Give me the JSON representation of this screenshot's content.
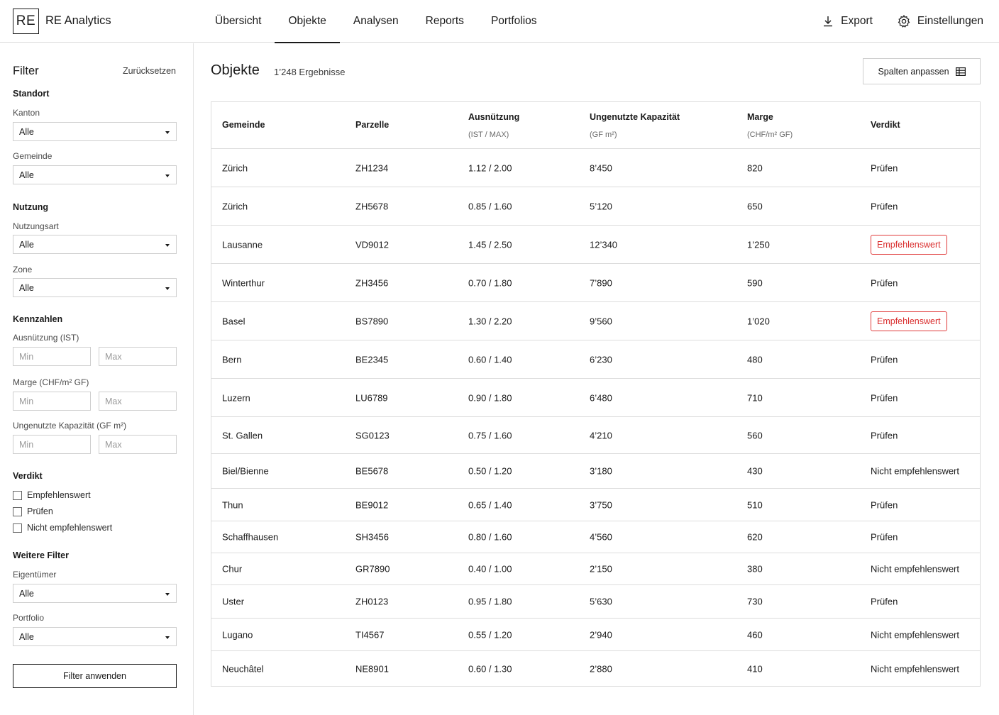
{
  "app": {
    "logo": "RE",
    "name": "RE Analytics"
  },
  "nav": {
    "tabs": [
      {
        "label": "Übersicht"
      },
      {
        "label": "Objekte",
        "active": true
      },
      {
        "label": "Analysen"
      },
      {
        "label": "Reports"
      },
      {
        "label": "Portfolios"
      }
    ],
    "export_label": "Export",
    "settings_label": "Einstellungen"
  },
  "sidebar": {
    "title": "Filter",
    "reset": "Zurücksetzen",
    "standort": {
      "title": "Standort",
      "kanton_label": "Kanton",
      "kanton_value": "Alle",
      "gemeinde_label": "Gemeinde",
      "gemeinde_value": "Alle"
    },
    "nutzung": {
      "title": "Nutzung",
      "nutzungsart_label": "Nutzungsart",
      "nutzungsart_value": "Alle",
      "zone_label": "Zone",
      "zone_value": "Alle"
    },
    "kennzahlen": {
      "title": "Kennzahlen",
      "ausnutzung_label": "Ausnützung (IST)",
      "marge_label": "Marge (CHF/m² GF)",
      "kapazitaet_label": "Ungenutzte Kapazität (GF m²)",
      "min_placeholder": "Min",
      "max_placeholder": "Max"
    },
    "verdikt": {
      "title": "Verdikt",
      "options": [
        "Empfehlenswert",
        "Prüfen",
        "Nicht empfehlenswert"
      ]
    },
    "weitere": {
      "title": "Weitere Filter",
      "eigentuemer_label": "Eigentümer",
      "eigentuemer_value": "Alle",
      "portfolio_label": "Portfolio",
      "portfolio_value": "Alle"
    },
    "apply": "Filter anwenden"
  },
  "main": {
    "title": "Objekte",
    "count": "1’248 Ergebnisse",
    "columns_button": "Spalten anpassen",
    "table": {
      "headers": [
        {
          "label": "Gemeinde",
          "sub": ""
        },
        {
          "label": "Parzelle",
          "sub": ""
        },
        {
          "label": "Ausnützung",
          "sub": "(IST / MAX)"
        },
        {
          "label": "Ungenutzte Kapazität",
          "sub": "(GF m²)"
        },
        {
          "label": "Marge",
          "sub": "(CHF/m² GF)"
        },
        {
          "label": "Verdikt",
          "sub": ""
        }
      ],
      "rows": [
        {
          "gemeinde": "Zürich",
          "parzelle": "ZH1234",
          "ausnuetzung": "1.12 / 2.00",
          "kapazitaet": "8’450",
          "marge": "820",
          "verdikt": "Prüfen",
          "highlight": false
        },
        {
          "gemeinde": "Zürich",
          "parzelle": "ZH5678",
          "ausnuetzung": "0.85 / 1.60",
          "kapazitaet": "5’120",
          "marge": "650",
          "verdikt": "Prüfen",
          "highlight": false
        },
        {
          "gemeinde": "Lausanne",
          "parzelle": "VD9012",
          "ausnuetzung": "1.45 / 2.50",
          "kapazitaet": "12’340",
          "marge": "1’250",
          "verdikt": "Empfehlenswert",
          "highlight": true
        },
        {
          "gemeinde": "Winterthur",
          "parzelle": "ZH3456",
          "ausnuetzung": "0.70 / 1.80",
          "kapazitaet": "7’890",
          "marge": "590",
          "verdikt": "Prüfen",
          "highlight": false
        },
        {
          "gemeinde": "Basel",
          "parzelle": "BS7890",
          "ausnuetzung": "1.30 / 2.20",
          "kapazitaet": "9’560",
          "marge": "1’020",
          "verdikt": "Empfehlenswert",
          "highlight": true
        },
        {
          "gemeinde": "Bern",
          "parzelle": "BE2345",
          "ausnuetzung": "0.60 / 1.40",
          "kapazitaet": "6’230",
          "marge": "480",
          "verdikt": "Prüfen",
          "highlight": false
        },
        {
          "gemeinde": "Luzern",
          "parzelle": "LU6789",
          "ausnuetzung": "0.90 / 1.80",
          "kapazitaet": "6’480",
          "marge": "710",
          "verdikt": "Prüfen",
          "highlight": false
        },
        {
          "gemeinde": "St. Gallen",
          "parzelle": "SG0123",
          "ausnuetzung": "0.75 / 1.60",
          "kapazitaet": "4’210",
          "marge": "560",
          "verdikt": "Prüfen",
          "highlight": false
        },
        {
          "gemeinde": "Biel/Bienne",
          "parzelle": "BE5678",
          "ausnuetzung": "0.50 / 1.20",
          "kapazitaet": "3’180",
          "marge": "430",
          "verdikt": "Nicht empfehlenswert",
          "highlight": false
        },
        {
          "gemeinde": "Thun",
          "parzelle": "BE9012",
          "ausnuetzung": "0.65 / 1.40",
          "kapazitaet": "3’750",
          "marge": "510",
          "verdikt": "Prüfen",
          "highlight": false
        },
        {
          "gemeinde": "Schaffhausen",
          "parzelle": "SH3456",
          "ausnuetzung": "0.80 / 1.60",
          "kapazitaet": "4’560",
          "marge": "620",
          "verdikt": "Prüfen",
          "highlight": false
        },
        {
          "gemeinde": "Chur",
          "parzelle": "GR7890",
          "ausnuetzung": "0.40 / 1.00",
          "kapazitaet": "2’150",
          "marge": "380",
          "verdikt": "Nicht empfehlenswert",
          "highlight": false
        },
        {
          "gemeinde": "Uster",
          "parzelle": "ZH0123",
          "ausnuetzung": "0.95 / 1.80",
          "kapazitaet": "5’630",
          "marge": "730",
          "verdikt": "Prüfen",
          "highlight": false
        },
        {
          "gemeinde": "Lugano",
          "parzelle": "TI4567",
          "ausnuetzung": "0.55 / 1.20",
          "kapazitaet": "2’940",
          "marge": "460",
          "verdikt": "Nicht empfehlenswert",
          "highlight": false
        },
        {
          "gemeinde": "Neuchâtel",
          "parzelle": "NE8901",
          "ausnuetzung": "0.60 / 1.30",
          "kapazitaet": "2’880",
          "marge": "410",
          "verdikt": "Nicht empfehlenswert",
          "highlight": false
        }
      ]
    }
  },
  "colors": {
    "accent_red": "#d92c2c",
    "border": "#dcdcdc",
    "text": "#1a1a1a"
  },
  "icons": {
    "export": "download-icon",
    "settings": "gear-icon",
    "columns": "table-columns-icon",
    "select": "caret-down-icon"
  }
}
